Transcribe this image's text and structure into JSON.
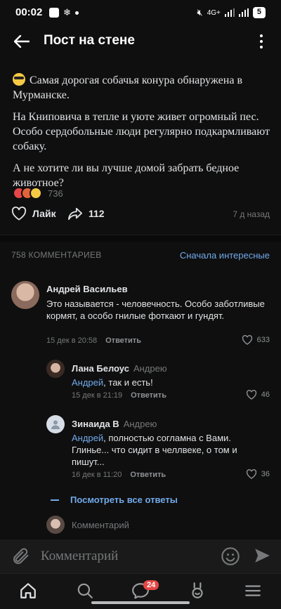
{
  "status_bar": {
    "time": "00:02",
    "network": "4G+",
    "battery": "5"
  },
  "header": {
    "title": "Пост на стене"
  },
  "post": {
    "paragraphs": [
      "Самая дорогая собачья конура обнаружена в Мурманске.",
      "На Книповича в тепле и уюте живет огромный пес. Особо сердобольные люди регулярно подкармливают собаку.",
      "А не хотите ли вы лучше домой забрать бедное животное?"
    ],
    "reactions_count": "736",
    "like_label": "Лайк",
    "share_count": "112",
    "date": "7 д назад"
  },
  "comments_header": {
    "count": "758 КОММЕНТАРИЕВ",
    "sort": "Сначала интересные"
  },
  "comments": [
    {
      "author": "Андрей Васильев",
      "reply_to": "",
      "mention": "",
      "text": "Это называется - человечность. Особо заботливые кормят, а особо гнилые фоткают и гундят.",
      "date": "15 дек в 20:58",
      "reply_label": "Ответить",
      "likes": "633"
    },
    {
      "author": "Лана Белоус",
      "reply_to": "Андрею",
      "mention": "Андрей",
      "text": ", так и есть!",
      "date": "15 дек в 21:19",
      "reply_label": "Ответить",
      "likes": "46"
    },
    {
      "author": "Зинаида В",
      "reply_to": "Андрею",
      "mention": "Андрей",
      "text": ", полностью согламна с Вами. Глинье... что сидит в челлвеке, о том и пишут...",
      "date": "16 дек в 11:20",
      "reply_label": "Ответить",
      "likes": "36"
    }
  ],
  "show_all_replies": "Посмотреть все ответы",
  "inline_comment_placeholder": "Комментарий",
  "composer": {
    "placeholder": "Комментарий"
  },
  "nav": {
    "messages_badge": "24"
  }
}
